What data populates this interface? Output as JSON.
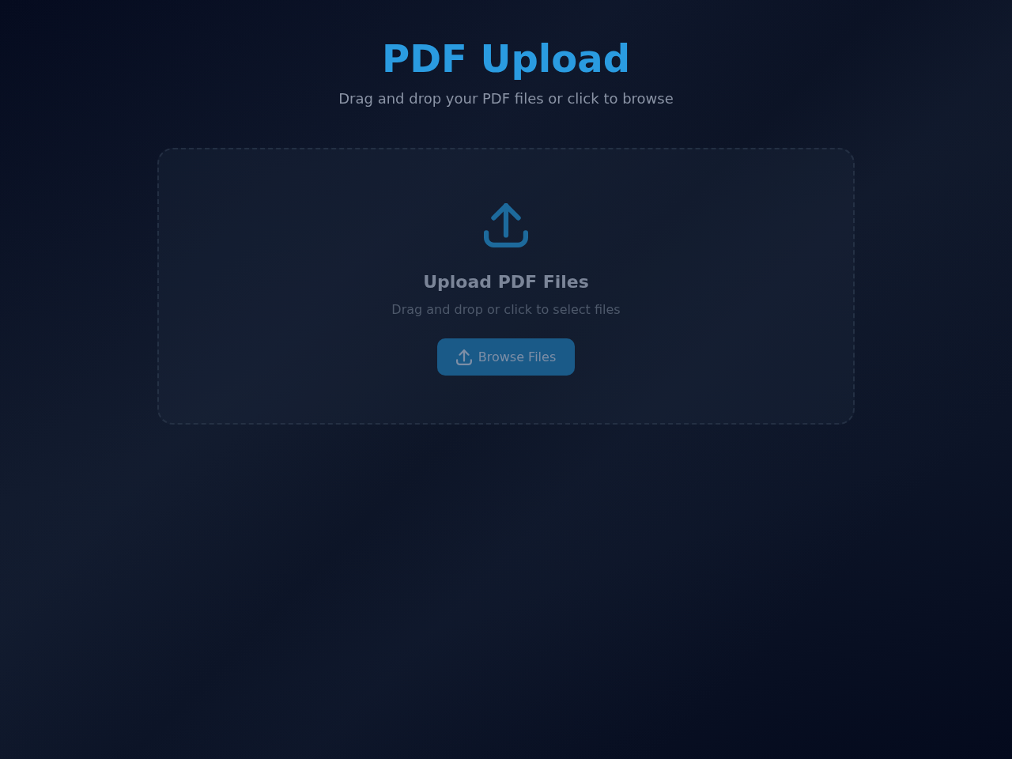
{
  "header": {
    "title": "PDF Upload",
    "subtitle": "Drag and drop your PDF files or click to browse"
  },
  "dropzone": {
    "heading": "Upload PDF Files",
    "hint": "Drag and drop or click to select files",
    "button": {
      "label": "Browse Files"
    }
  }
}
